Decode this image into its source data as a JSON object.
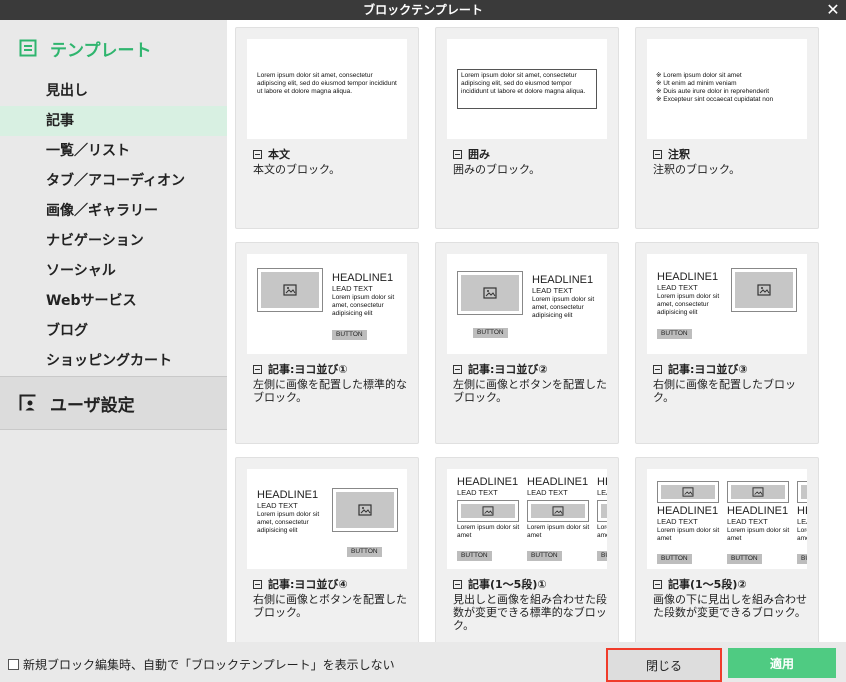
{
  "window": {
    "title": "ブロックテンプレート"
  },
  "sidebar": {
    "section_templates": "テンプレート",
    "items": [
      "見出し",
      "記事",
      "一覧／リスト",
      "タブ／アコーディオン",
      "画像／ギャラリー",
      "ナビゲーション",
      "ソーシャル",
      "Webサービス",
      "ブログ",
      "ショッピングカート"
    ],
    "section_user": "ユーザ設定"
  },
  "preview": {
    "lorem": "Lorem ipsum dolor sit amet, consectetur adipiscing elit, sed do eiusmod tempor incididunt ut labore et dolore magna aliqua.",
    "notes": [
      "※ Lorem ipsum dolor sit amet",
      "※ Ut enim ad minim veniam",
      "※ Duis aute irure dolor in reprehenderit",
      "※ Excepteur sint occaecat cupidatat non"
    ],
    "headline": "HEADLINE1",
    "lead": "LEAD TEXT",
    "short_lorem": "Lorem ipsum dolor sit amet, consectetur adipisicing elit",
    "short_lorem2": "Lorem ipsum dolor sit amet",
    "button": "BUTTON"
  },
  "cards": [
    {
      "title": "本文",
      "desc": "本文のブロック。"
    },
    {
      "title": "囲み",
      "desc": "囲みのブロック。"
    },
    {
      "title": "注釈",
      "desc": "注釈のブロック。"
    },
    {
      "title": "記事:ヨコ並び①",
      "desc": "左側に画像を配置した標準的なブロック。"
    },
    {
      "title": "記事:ヨコ並び②",
      "desc": "左側に画像とボタンを配置したブロック。"
    },
    {
      "title": "記事:ヨコ並び③",
      "desc": "右側に画像を配置したブロック。"
    },
    {
      "title": "記事:ヨコ並び④",
      "desc": "右側に画像とボタンを配置したブロック。"
    },
    {
      "title": "記事(1〜5段)①",
      "desc": "見出しと画像を組み合わせた段数が変更できる標準的なブロック。"
    },
    {
      "title": "記事(1〜5段)②",
      "desc": "画像の下に見出しを組み合わせた段数が変更できるブロック。"
    }
  ],
  "footer": {
    "checkbox_label": "新規ブロック編集時、自動で「ブロックテンプレート」を表示しない",
    "close_label": "閉じる",
    "apply_label": "適用"
  },
  "colors": {
    "accent": "#2fb56e",
    "apply": "#4fcb82",
    "highlight": "#f03b2a"
  }
}
